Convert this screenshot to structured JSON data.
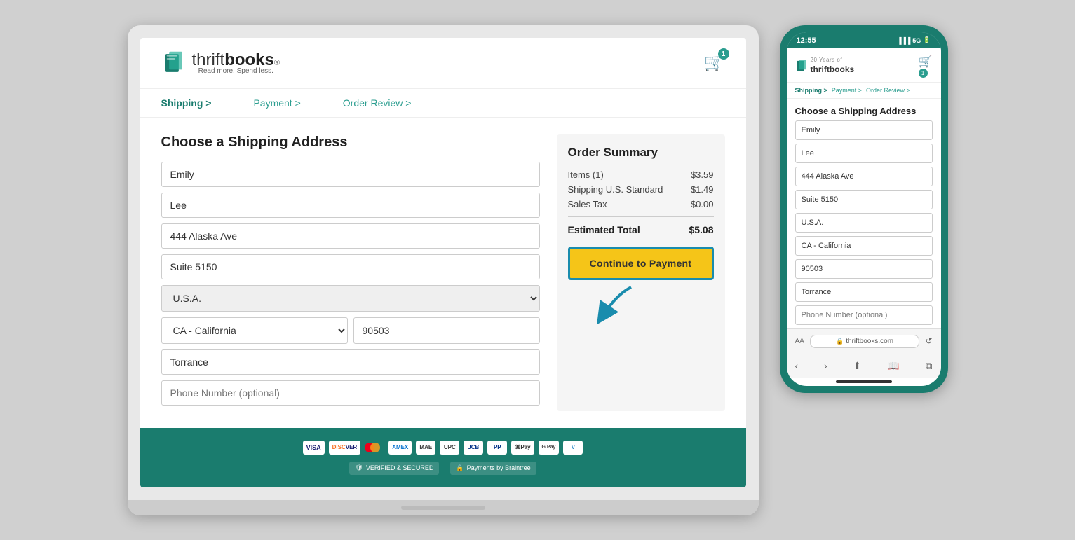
{
  "laptop": {
    "header": {
      "logo_text_plain": "thrift",
      "logo_text_bold": "books",
      "logo_registered": "®",
      "logo_tagline": "Read more. Spend less.",
      "cart_count": "1"
    },
    "breadcrumb": {
      "shipping": "Shipping >",
      "payment": "Payment >",
      "order_review": "Order Review >"
    },
    "form": {
      "title": "Choose a Shipping Address",
      "first_name": "Emily",
      "last_name": "Lee",
      "address1": "444 Alaska Ave",
      "address2": "Suite 5150",
      "country": "U.S.A.",
      "state": "CA - California",
      "zip": "90503",
      "city": "Torrance",
      "phone_placeholder": "Phone Number (optional)"
    },
    "order_summary": {
      "title": "Order Summary",
      "items_label": "Items (1)",
      "items_value": "$3.59",
      "shipping_label": "Shipping U.S. Standard",
      "shipping_value": "$1.49",
      "tax_label": "Sales Tax",
      "tax_value": "$0.00",
      "total_label": "Estimated Total",
      "total_value": "$5.08",
      "continue_btn": "Continue to Payment"
    }
  },
  "phone": {
    "status_bar": {
      "time": "12:55",
      "signal": "5G▐"
    },
    "header": {
      "logo_text": "thriftbooks",
      "cart_count": "1"
    },
    "breadcrumb": {
      "shipping": "Shipping >",
      "payment": "Payment >",
      "order_review": "Order Review >"
    },
    "form": {
      "title": "Choose a Shipping Address",
      "first_name": "Emily",
      "last_name": "Lee",
      "address1": "444 Alaska Ave",
      "address2": "Suite 5150",
      "country": "U.S.A.",
      "state": "CA - California",
      "zip": "90503",
      "city": "Torrance",
      "phone_placeholder": "Phone Number (optional)"
    },
    "address_bar": {
      "aa": "AA",
      "url": "thriftbooks.com"
    }
  },
  "icons": {
    "cart": "🛒",
    "chevron_down": "▾",
    "shield": "🔒",
    "lock": "🔒",
    "back": "‹",
    "forward": "›",
    "share": "⬆",
    "bookmark": "📖",
    "tabs": "⧉",
    "refresh": "↺"
  },
  "payment_methods": [
    "VISA",
    "DISC",
    "MC",
    "AMEX",
    "MAE",
    "UPC",
    "JCB",
    "PP",
    "APay",
    "GPay",
    "Venmo"
  ],
  "security": {
    "verified": "VERIFIED & SECURED",
    "braintree": "Payments by Braintree"
  }
}
